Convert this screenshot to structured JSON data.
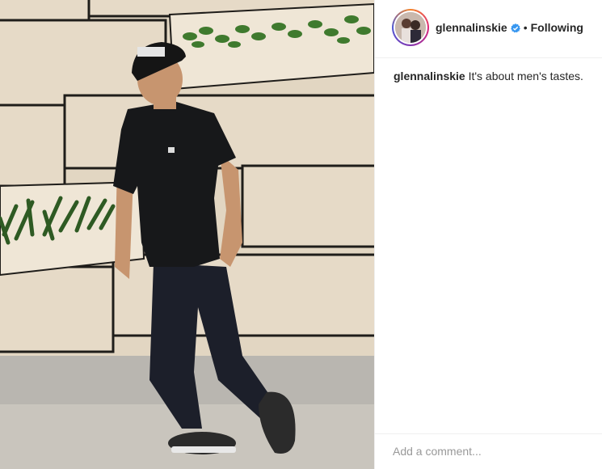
{
  "post": {
    "photo": {
      "alt": "Man in black cap, black t-shirt and dark jeans standing in front of a wood-panel wall with planters"
    },
    "header": {
      "username": "glennalinskie",
      "verified_icon": "verified-badge-icon",
      "separator": "•",
      "follow_label": "Following"
    },
    "caption": {
      "username": "glennalinskie",
      "text": "It's about men's tastes."
    },
    "comment": {
      "placeholder": "Add a comment..."
    },
    "colors": {
      "verified_blue": "#3897f0",
      "text": "#262626",
      "placeholder": "#999999",
      "divider": "#efefef"
    }
  }
}
